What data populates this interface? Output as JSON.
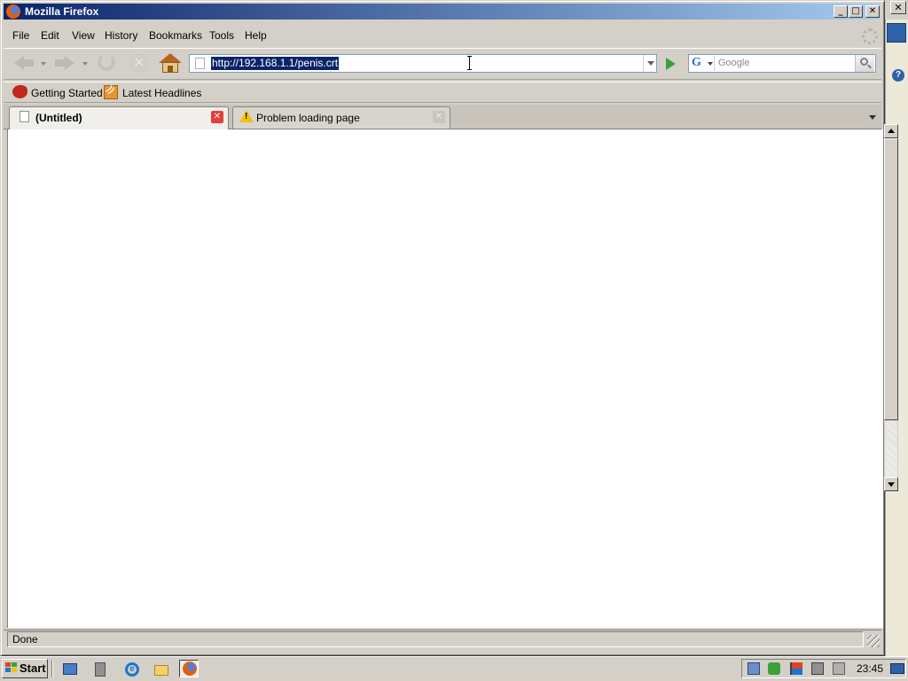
{
  "window": {
    "title": "Mozilla Firefox",
    "minimize_label": "_",
    "maximize_label": "□",
    "close_label": "✕"
  },
  "menu": {
    "items": [
      {
        "label": "File"
      },
      {
        "label": "Edit"
      },
      {
        "label": "View"
      },
      {
        "label": "History"
      },
      {
        "label": "Bookmarks"
      },
      {
        "label": "Tools"
      },
      {
        "label": "Help"
      }
    ]
  },
  "navigation": {
    "url": "http://192.168.1.1/penis.crt",
    "url_selected": true,
    "search_engine": "G",
    "search_placeholder": "Google",
    "icons": [
      "back-icon",
      "forward-icon",
      "reload-icon",
      "stop-icon",
      "home-icon",
      "go-icon",
      "search-icon"
    ]
  },
  "bookmarks": {
    "items": [
      {
        "label": "Getting Started",
        "icon": "firefox-bookmark-icon"
      },
      {
        "label": "Latest Headlines",
        "icon": "rss-feed-icon"
      }
    ]
  },
  "tabs": [
    {
      "label": "(Untitled)",
      "active": true,
      "icon": "blank-page-icon",
      "close_label": "✕"
    },
    {
      "label": "Problem loading page",
      "active": false,
      "icon": "warning-icon",
      "close_label": "✕"
    }
  ],
  "status": {
    "text": "Done"
  },
  "taskbar": {
    "start_label": "Start",
    "clock": "23:45",
    "quick_launch": [
      "explorer-icon",
      "speaker-icon",
      "internet-explorer-icon",
      "folder-icon",
      "firefox-icon"
    ],
    "tray_icons": [
      "tray-network-icon",
      "tray-security-icon",
      "tray-flag-icon",
      "tray-display-icon",
      "tray-speaker-muted-icon"
    ]
  },
  "colors": {
    "title_gradient_start": "#0a246a",
    "title_gradient_end": "#a6caf0",
    "selection": "#0a246a",
    "go_arrow": "#3aa13a"
  }
}
